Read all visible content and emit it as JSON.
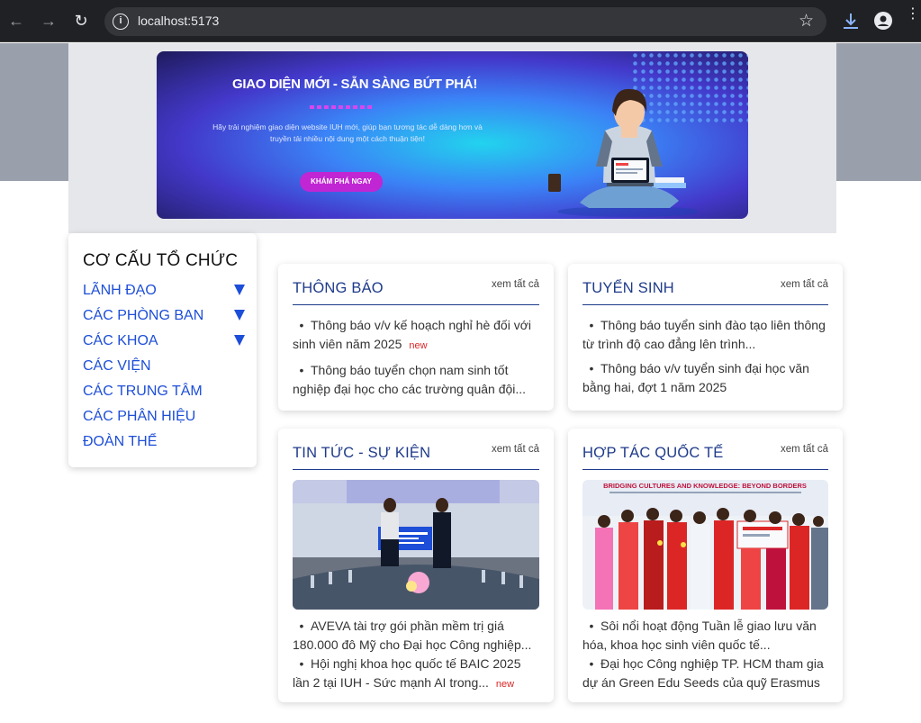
{
  "browser": {
    "url": "localhost:5173",
    "back_icon": "arrow-left-icon",
    "forward_icon": "arrow-right-icon",
    "reload_icon": "reload-icon"
  },
  "banner": {
    "headline": "GIAO DIỆN MỚI - SẴN SÀNG BỨT PHÁ!",
    "description": "Hãy trải nghiệm giao diện website IUH mới, giúp bạn tương tác dễ dàng hơn và truyền tải nhiều nội dung một cách thuận tiện!",
    "cta": "KHÁM PHÁ NGAY",
    "accent": "#c026d3"
  },
  "sidebar": {
    "title": "CƠ CẤU TỔ CHỨC",
    "items": [
      {
        "label": "LÃNH ĐẠO",
        "expandable": true
      },
      {
        "label": "CÁC PHÒNG BAN",
        "expandable": true
      },
      {
        "label": "CÁC KHOA",
        "expandable": true
      },
      {
        "label": "CÁC VIỆN",
        "expandable": false
      },
      {
        "label": "CÁC TRUNG TÂM",
        "expandable": false
      },
      {
        "label": "CÁC PHÂN HIỆU",
        "expandable": false
      },
      {
        "label": "ĐOÀN THỂ",
        "expandable": false
      }
    ]
  },
  "cards": {
    "thong_bao": {
      "title": "THÔNG BÁO",
      "see_all": "xem tất cả",
      "items": [
        {
          "text": "Thông báo v/v kế hoạch nghỉ hè đối với sinh viên năm 2025",
          "badge": "new"
        },
        {
          "text": "Thông báo tuyển chọn nam sinh tốt nghiệp đại học cho các trường quân đội..."
        }
      ]
    },
    "tuyen_sinh": {
      "title": "TUYỂN SINH",
      "see_all": "xem tất cả",
      "items": [
        {
          "text": "Thông báo tuyển sinh đào tạo liên thông từ trình độ cao đẳng lên trình..."
        },
        {
          "text": "Thông báo v/v tuyển sinh đại học văn bằng hai, đợt 1 năm 2025"
        }
      ]
    },
    "tin_tuc": {
      "title": "TIN TỨC - SỰ KIỆN",
      "see_all": "xem tất cả",
      "items": [
        {
          "text": "AVEVA tài trợ gói phần mềm trị giá 180.000 đô Mỹ cho Đại học Công nghiệp..."
        },
        {
          "text": "Hội nghị khoa học quốc tế BAIC 2025 lần 2 tại IUH - Sức mạnh AI trong...",
          "badge": "new"
        }
      ]
    },
    "hop_tac": {
      "title": "HỢP TÁC QUỐC TẾ",
      "see_all": "xem tất cả",
      "photo_banner_text": "BRIDGING CULTURES AND KNOWLEDGE: BEYOND BORDERS",
      "items": [
        {
          "text": "Sôi nổi hoạt động Tuần lễ giao lưu văn hóa, khoa học sinh viên quốc tế..."
        },
        {
          "text": "Đại học Công nghiệp TP. HCM tham gia dự án Green Edu Seeds của quỹ Erasmus"
        }
      ]
    }
  },
  "colors": {
    "link_blue": "#1d4ed8",
    "heading_navy": "#1e3a8a",
    "new_badge": "#dc2626"
  }
}
